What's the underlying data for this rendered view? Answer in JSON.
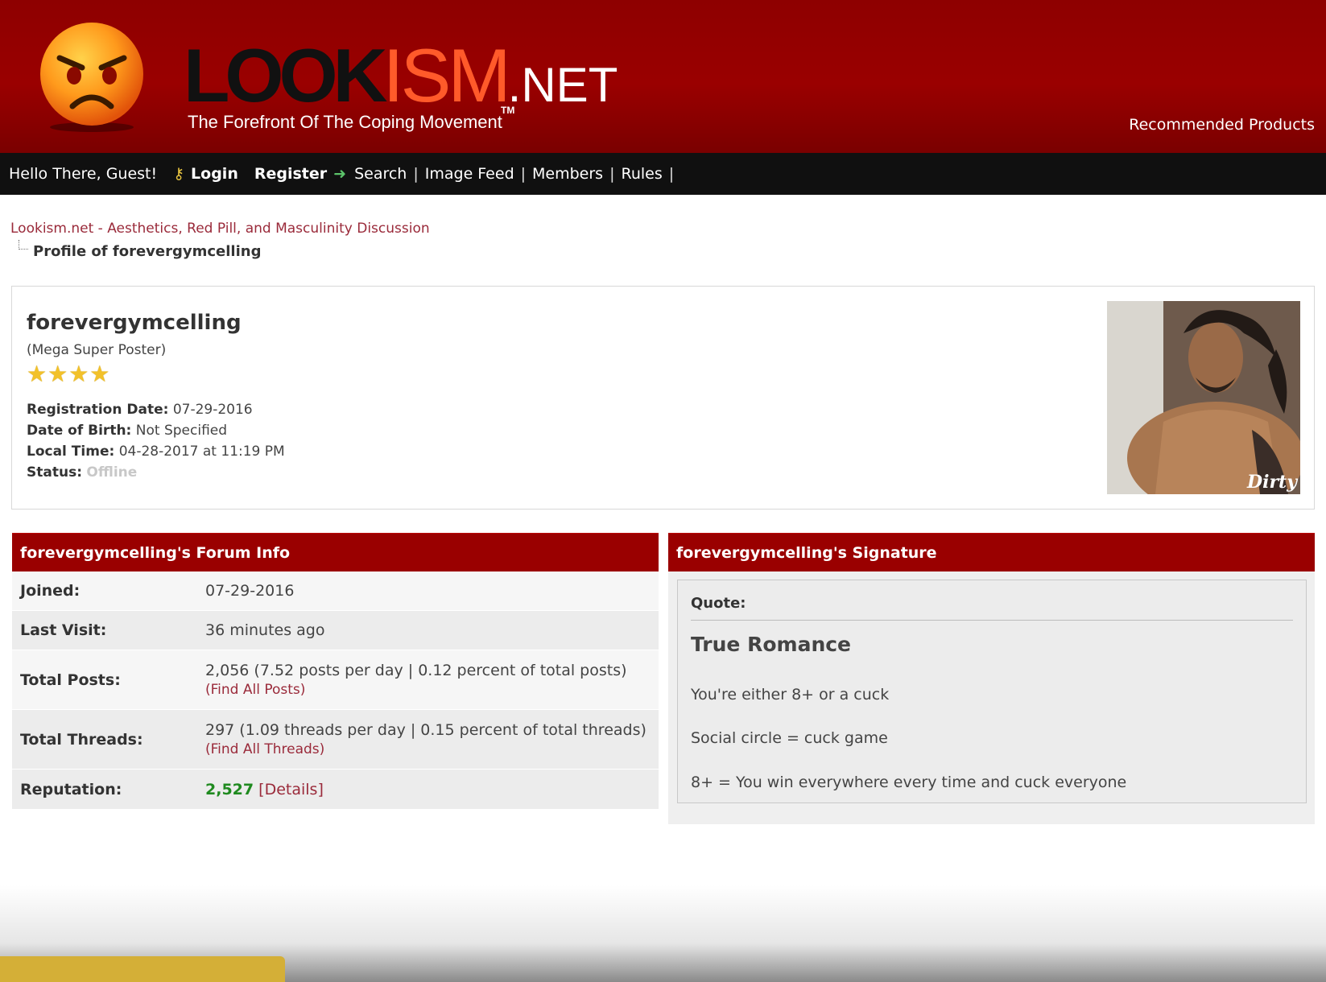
{
  "header": {
    "logo_look": "LOOK",
    "logo_ism": "ISM",
    "logo_net": ".NET",
    "tagline": "The Forefront Of The Coping Movement",
    "trademark": "TM",
    "recommended": "Recommended Products",
    "emoji_icon": "angry-face-icon"
  },
  "nav": {
    "greeting": "Hello There, Guest!",
    "login": "Login",
    "register": "Register",
    "links": [
      "Search",
      "Image Feed",
      "Members",
      "Rules"
    ],
    "separator": "|"
  },
  "breadcrumb": {
    "root": "Lookism.net - Aesthetics, Red Pill, and Masculinity Discussion",
    "current": "Profile of forevergymcelling"
  },
  "profile": {
    "username": "forevergymcelling",
    "user_title": "(Mega Super Poster)",
    "stars": "★★★★",
    "star_count": 4,
    "registration_label": "Registration Date:",
    "registration_value": "07-29-2016",
    "dob_label": "Date of Birth:",
    "dob_value": "Not Specified",
    "local_time_label": "Local Time:",
    "local_time_value": "04-28-2017 at 11:19 PM",
    "status_label": "Status:",
    "status_value": "Offline",
    "avatar_watermark": "Dirty"
  },
  "forum_info": {
    "title": "forevergymcelling's Forum Info",
    "joined_label": "Joined:",
    "joined_value": "07-29-2016",
    "last_visit_label": "Last Visit:",
    "last_visit_value": "36 minutes ago",
    "total_posts_label": "Total Posts:",
    "total_posts_value": "2,056 (7.52 posts per day | 0.12 percent of total posts)",
    "find_posts": "(Find All Posts)",
    "total_threads_label": "Total Threads:",
    "total_threads_value": "297 (1.09 threads per day | 0.15 percent of total threads)",
    "find_threads": "(Find All Threads)",
    "reputation_label": "Reputation:",
    "reputation_value": "2,527",
    "reputation_details": "[Details]"
  },
  "signature": {
    "title": "forevergymcelling's Signature",
    "quote_label": "Quote:",
    "heading": "True Romance",
    "lines": [
      "You're either 8+ or a cuck",
      "Social circle = cuck game",
      "8+ = You win everywhere every time and cuck everyone"
    ]
  },
  "colors": {
    "header_red": "#9a0000",
    "nav_black": "#101010",
    "link_red": "#9a2a3a",
    "reputation_green": "#1f8a1f",
    "accent_orange": "#ff5a2a",
    "bottom_gold": "#d4af37"
  }
}
